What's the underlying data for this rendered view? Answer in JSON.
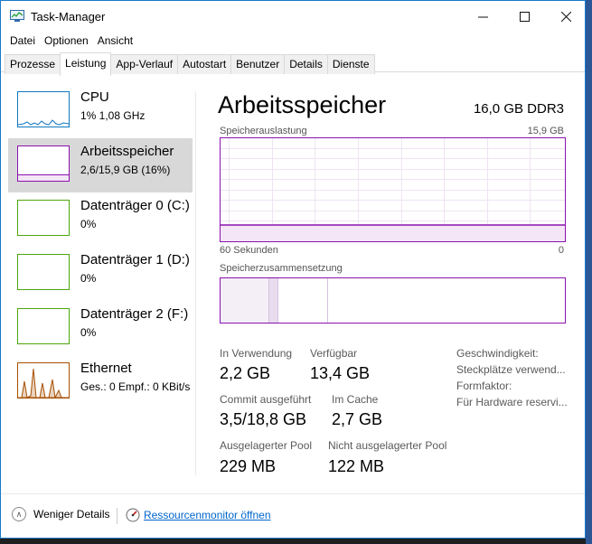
{
  "window": {
    "title": "Task-Manager"
  },
  "menu": [
    "Datei",
    "Optionen",
    "Ansicht"
  ],
  "tabs": [
    "Prozesse",
    "Leistung",
    "App-Verlauf",
    "Autostart",
    "Benutzer",
    "Details",
    "Dienste"
  ],
  "active_tab": "Leistung",
  "sidebar": [
    {
      "name": "CPU",
      "value": "1% 1,08 GHz",
      "color": "#1178be"
    },
    {
      "name": "Arbeitsspeicher",
      "value": "2,6/15,9 GB (16%)",
      "color": "#8b12ae"
    },
    {
      "name": "Datenträger 0 (C:)",
      "value": "0%",
      "color": "#4da60c"
    },
    {
      "name": "Datenträger 1 (D:)",
      "value": "0%",
      "color": "#4da60c"
    },
    {
      "name": "Datenträger 2 (F:)",
      "value": "0%",
      "color": "#4da60c"
    },
    {
      "name": "Ethernet",
      "value_prefix": "Ges.: 0 Empf.: 0 KBit/s",
      "color": "#a74f01"
    }
  ],
  "main": {
    "title": "Arbeitsspeicher",
    "spec": "16,0 GB DDR3",
    "usage_label": "Speicherauslastung",
    "usage_max": "15,9 GB",
    "time_left": "60 Sekunden",
    "time_right": "0",
    "usage_level": 0.16,
    "composition_label": "Speicherzusammensetzung",
    "stats": {
      "in_use_label": "In Verwendung",
      "in_use": "2,2 GB",
      "available_label": "Verfügbar",
      "available": "13,4 GB",
      "commit_label": "Commit ausgeführt",
      "commit": "3,5/18,8 GB",
      "cached_label": "Im Cache",
      "cached": "2,7 GB",
      "paged_label": "Ausgelagerter Pool",
      "paged": "229 MB",
      "nonpaged_label": "Nicht ausgelagerter Pool",
      "nonpaged": "122 MB"
    },
    "right": [
      "Geschwindigkeit:",
      "Steckplätze verwend...",
      "Formfaktor:",
      "Für Hardware reservi..."
    ]
  },
  "footer": {
    "fewer_details": "Weniger Details",
    "resmon": "Ressourcenmonitor öffnen"
  }
}
